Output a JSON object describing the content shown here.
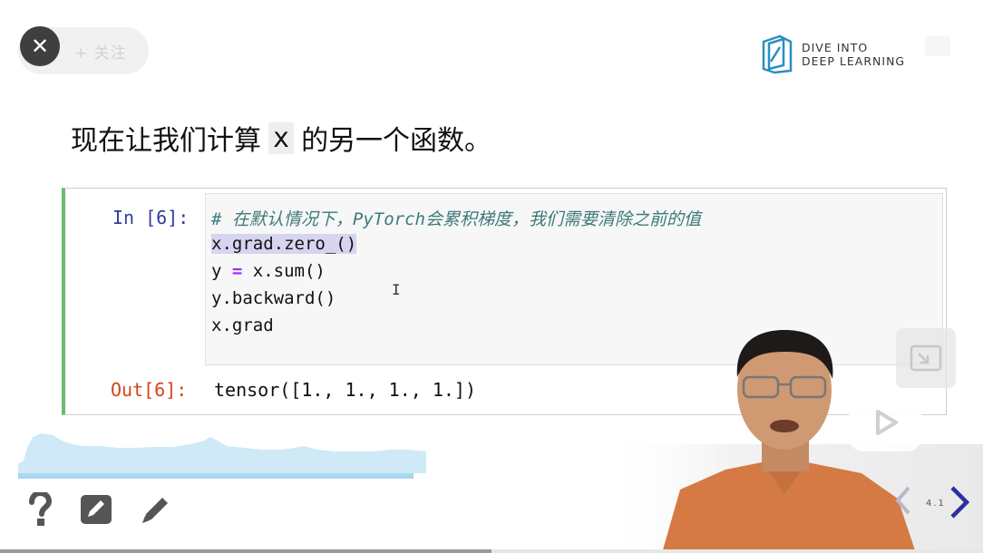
{
  "player": {
    "follow_label": "+ 关注",
    "close_icon": "close-icon",
    "play_icon": "play-icon",
    "pip_icon": "picture-in-picture-icon",
    "progress_fraction": 0.5
  },
  "logo": {
    "line1": "DIVE INTO",
    "line2": "DEEP LEARNING",
    "color": "#2a8fc2"
  },
  "slide": {
    "heading_before": "现在让我们计算",
    "heading_code": "x",
    "heading_after": "的另一个函数。",
    "slide_number": "4.1"
  },
  "cell": {
    "in_prompt": "In [6]:",
    "code": {
      "comment": "# 在默认情况下，PyTorch会累积梯度，我们需要清除之前的值",
      "line2": "x.grad.zero_()",
      "line3_a": "y ",
      "line3_op": "=",
      "line3_b": " x.sum()",
      "line4": "y.backward()",
      "line5": "x.grad"
    },
    "out_prompt": "Out[6]:",
    "output": "tensor([1., 1., 1., 1.])",
    "text_cursor": "I",
    "colors": {
      "in_prompt": "#303f9f",
      "out_prompt": "#d84315",
      "border_active": "#6abb6d",
      "comment": "#3d7a7a",
      "operator": "#aa22ff"
    }
  },
  "toolbar": {
    "help_icon": "question-icon",
    "edit_box_icon": "edit-box-icon",
    "pencil_icon": "pencil-icon"
  }
}
